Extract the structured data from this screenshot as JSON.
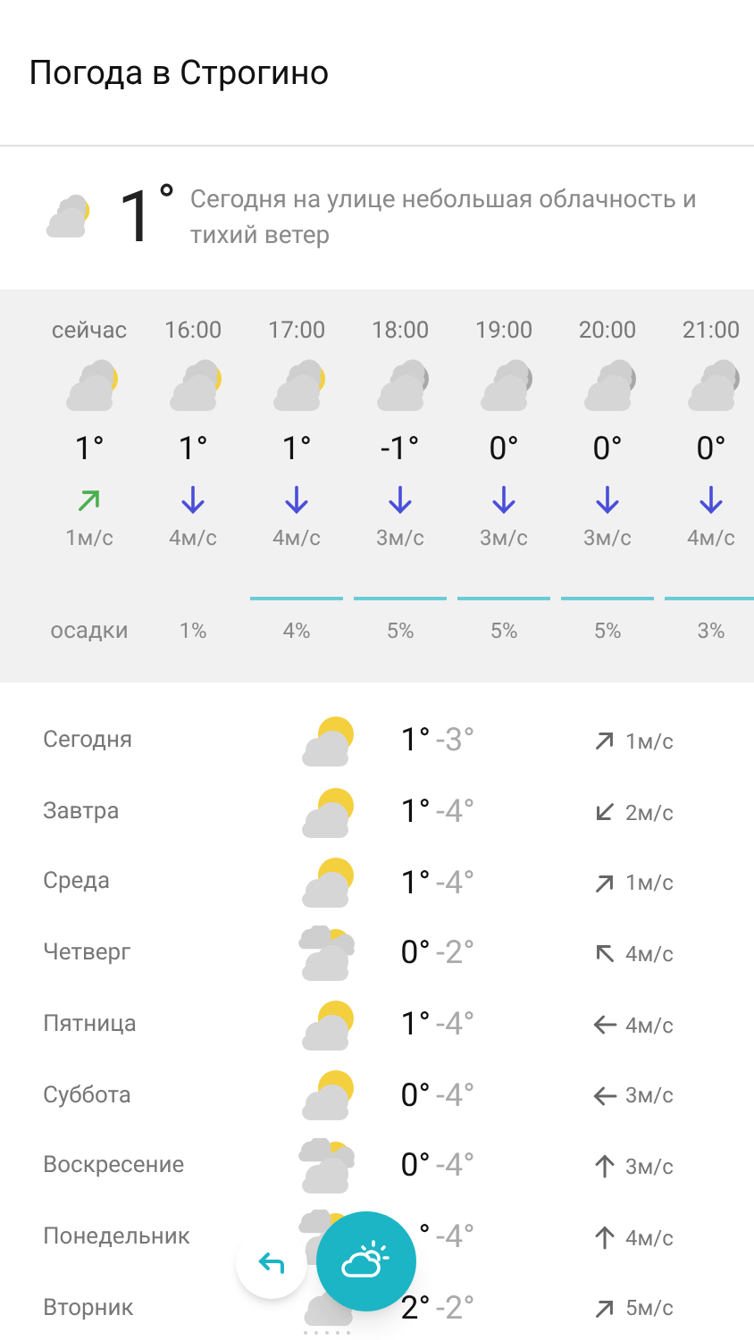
{
  "title": "Погода в Строгино",
  "current": {
    "kind": "partly_cloudy_day",
    "temp": "1",
    "degree": "°",
    "summary": "Сегодня на улице небольшая облачность и тихий ветер"
  },
  "hourly": [
    {
      "time": "сейчас",
      "kind": "partly_cloudy_day",
      "temp": "1°",
      "arrow": {
        "kind": "ne",
        "color": "#4caf50"
      },
      "wind": "1м/с",
      "precip_line": false
    },
    {
      "time": "16:00",
      "kind": "partly_cloudy_day",
      "temp": "1°",
      "arrow": {
        "kind": "s",
        "color": "#4a4fd8"
      },
      "wind": "4м/с",
      "precip": "1%",
      "precip_line": false
    },
    {
      "time": "17:00",
      "kind": "partly_cloudy_day",
      "temp": "1°",
      "arrow": {
        "kind": "s",
        "color": "#4a4fd8"
      },
      "wind": "4м/с",
      "precip": "4%",
      "precip_line": true
    },
    {
      "time": "18:00",
      "kind": "partly_cloudy_night",
      "temp": "-1°",
      "arrow": {
        "kind": "s",
        "color": "#4a4fd8"
      },
      "wind": "3м/с",
      "precip": "5%",
      "precip_line": true
    },
    {
      "time": "19:00",
      "kind": "partly_cloudy_night",
      "temp": "0°",
      "arrow": {
        "kind": "s",
        "color": "#4a4fd8"
      },
      "wind": "3м/с",
      "precip": "5%",
      "precip_line": true
    },
    {
      "time": "20:00",
      "kind": "partly_cloudy_night",
      "temp": "0°",
      "arrow": {
        "kind": "s",
        "color": "#4a4fd8"
      },
      "wind": "3м/с",
      "precip": "5%",
      "precip_line": true
    },
    {
      "time": "21:00",
      "kind": "partly_cloudy_night",
      "temp": "0°",
      "arrow": {
        "kind": "s",
        "color": "#4a4fd8"
      },
      "wind": "4м/с",
      "precip": "3%",
      "precip_line": true
    }
  ],
  "precip_label": "осадки",
  "daily": [
    {
      "day": "Сегодня",
      "kind": "sun_cloud",
      "high": "1°",
      "low": "-3°",
      "arrow": {
        "kind": "ne"
      },
      "wind": "1м/с"
    },
    {
      "day": "Завтра",
      "kind": "sun_cloud",
      "high": "1°",
      "low": "-4°",
      "arrow": {
        "kind": "sw"
      },
      "wind": "2м/с"
    },
    {
      "day": "Среда",
      "kind": "sun_cloud",
      "high": "1°",
      "low": "-4°",
      "arrow": {
        "kind": "ne"
      },
      "wind": "1м/с"
    },
    {
      "day": "Четверг",
      "kind": "sun_clouds",
      "high": "0°",
      "low": "-2°",
      "arrow": {
        "kind": "nw"
      },
      "wind": "4м/с"
    },
    {
      "day": "Пятница",
      "kind": "sun_cloud",
      "high": "1°",
      "low": "-4°",
      "arrow": {
        "kind": "w"
      },
      "wind": "4м/с"
    },
    {
      "day": "Суббота",
      "kind": "sun_cloud",
      "high": "0°",
      "low": "-4°",
      "arrow": {
        "kind": "w"
      },
      "wind": "3м/с"
    },
    {
      "day": "Воскресение",
      "kind": "sun_clouds",
      "high": "0°",
      "low": "-4°",
      "arrow": {
        "kind": "n"
      },
      "wind": "3м/с"
    },
    {
      "day": "Понедельник",
      "kind": "sun_clouds",
      "high": "°",
      "low": "-4°",
      "arrow": {
        "kind": "n"
      },
      "wind": "4м/с"
    },
    {
      "day": "Вторник",
      "kind": "snow_cloud",
      "high": "2°",
      "low": "-2°",
      "arrow": {
        "kind": "ne"
      },
      "wind": "5м/с"
    }
  ]
}
